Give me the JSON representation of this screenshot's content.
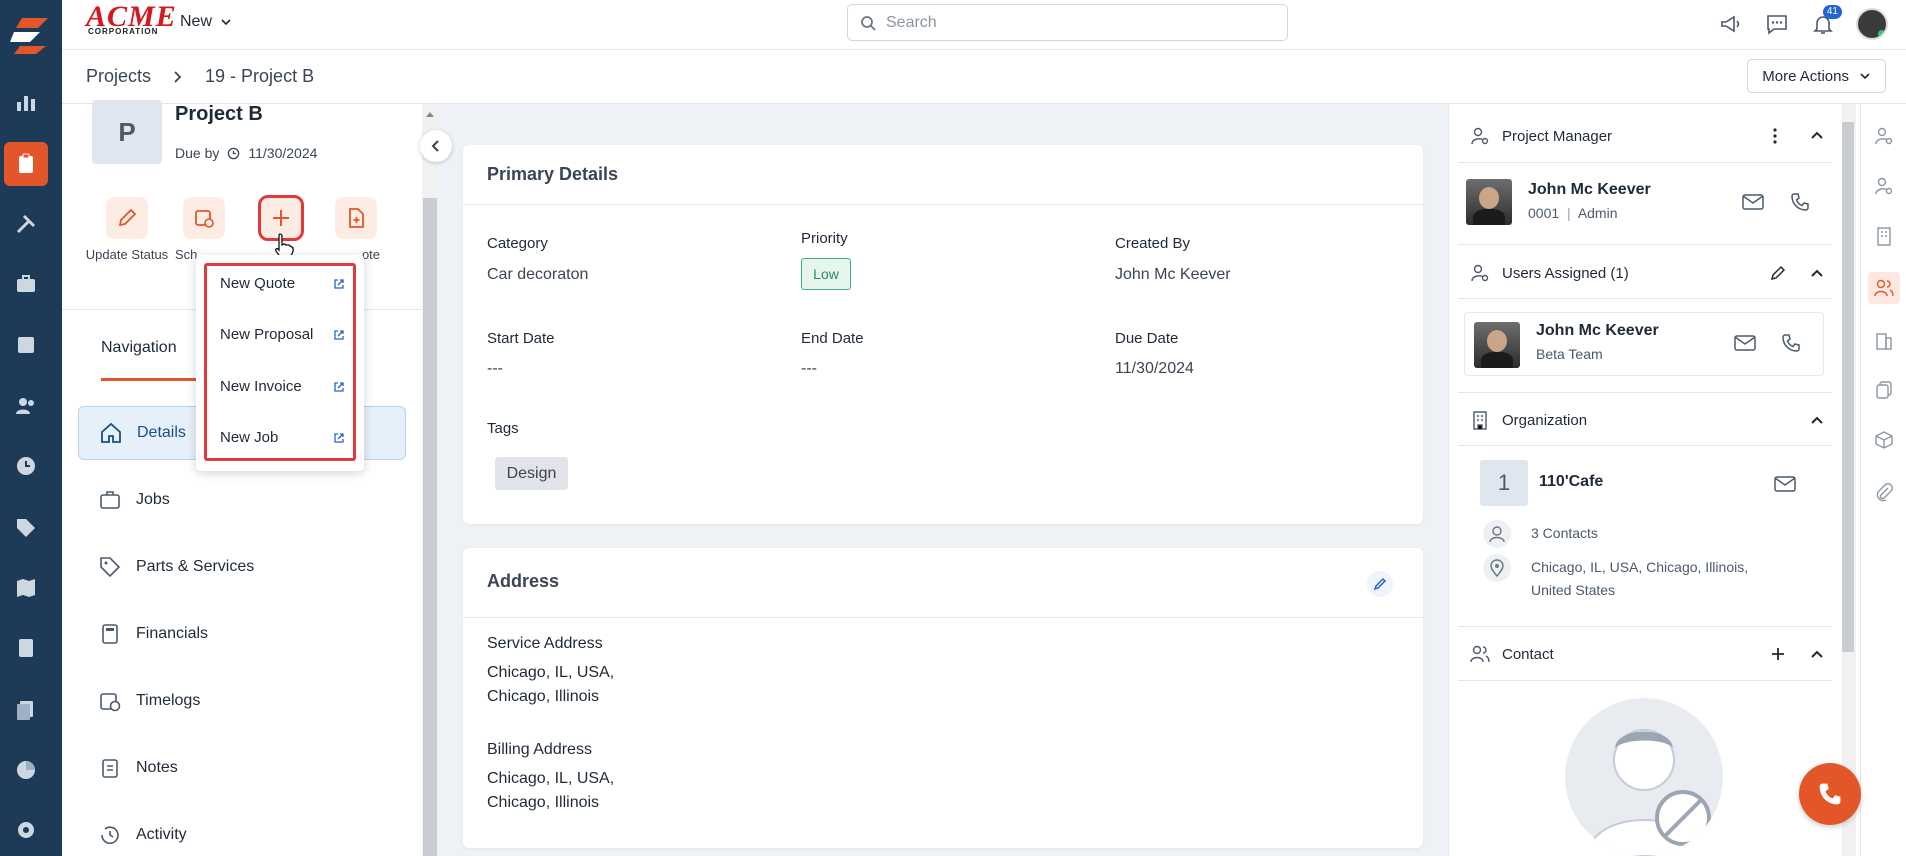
{
  "app": {
    "brand": "ACME",
    "brand_sub": "CORPORATION",
    "new_label": "New"
  },
  "search": {
    "placeholder": "Search"
  },
  "notifications": {
    "count": "41"
  },
  "breadcrumb": {
    "root": "Projects",
    "current": "19 - Project B"
  },
  "more_actions": "More Actions",
  "project": {
    "initial": "P",
    "name": "Project B",
    "due_label": "Due by",
    "due_date": "11/30/2024"
  },
  "quick_actions": [
    {
      "label": "Update Status",
      "icon": "pencil-icon"
    },
    {
      "label": "Sch",
      "icon": "calendar-clock-icon"
    },
    {
      "label": "",
      "icon": "plus-icon"
    },
    {
      "label": "ote",
      "icon": "file-plus-icon"
    }
  ],
  "dropdown": {
    "items": [
      {
        "label": "New Quote"
      },
      {
        "label": "New Proposal"
      },
      {
        "label": "New Invoice"
      },
      {
        "label": "New Job"
      }
    ]
  },
  "navigation": {
    "tab": "Navigation",
    "items": [
      {
        "label": "Details",
        "icon": "home-icon"
      },
      {
        "label": "Jobs",
        "icon": "briefcase-icon"
      },
      {
        "label": "Parts & Services",
        "icon": "tag-icon"
      },
      {
        "label": "Financials",
        "icon": "calculator-icon"
      },
      {
        "label": "Timelogs",
        "icon": "calendar-clock-icon"
      },
      {
        "label": "Notes",
        "icon": "clipboard-icon"
      },
      {
        "label": "Activity",
        "icon": "history-icon"
      }
    ]
  },
  "primary_details": {
    "title": "Primary Details",
    "category_label": "Category",
    "category": "Car decoraton",
    "priority_label": "Priority",
    "priority": "Low",
    "created_by_label": "Created By",
    "created_by": "John Mc Keever",
    "start_label": "Start Date",
    "start": "---",
    "end_label": "End Date",
    "end": "---",
    "due_label": "Due Date",
    "due": "11/30/2024",
    "tags_label": "Tags",
    "tags": [
      "Design"
    ]
  },
  "address": {
    "title": "Address",
    "service_label": "Service Address",
    "service_line1": "Chicago, IL, USA,",
    "service_line2": "Chicago, Illinois",
    "billing_label": "Billing Address",
    "billing_line1": "Chicago, IL, USA,",
    "billing_line2": "Chicago, Illinois"
  },
  "right": {
    "manager": {
      "title": "Project Manager",
      "name": "John Mc Keever",
      "id": "0001",
      "role": "Admin"
    },
    "assigned": {
      "title": "Users Assigned (1)",
      "name": "John Mc Keever",
      "team": "Beta Team"
    },
    "organization": {
      "title": "Organization",
      "number": "1",
      "name": "110'Cafe",
      "contacts": "3 Contacts",
      "address_line1": "Chicago, IL, USA, Chicago, Illinois,",
      "address_line2": "United States"
    },
    "contact": {
      "title": "Contact"
    }
  },
  "colors": {
    "accent": "#e2562a",
    "rail": "#1d3a56",
    "highlight": "#e03a3a"
  }
}
